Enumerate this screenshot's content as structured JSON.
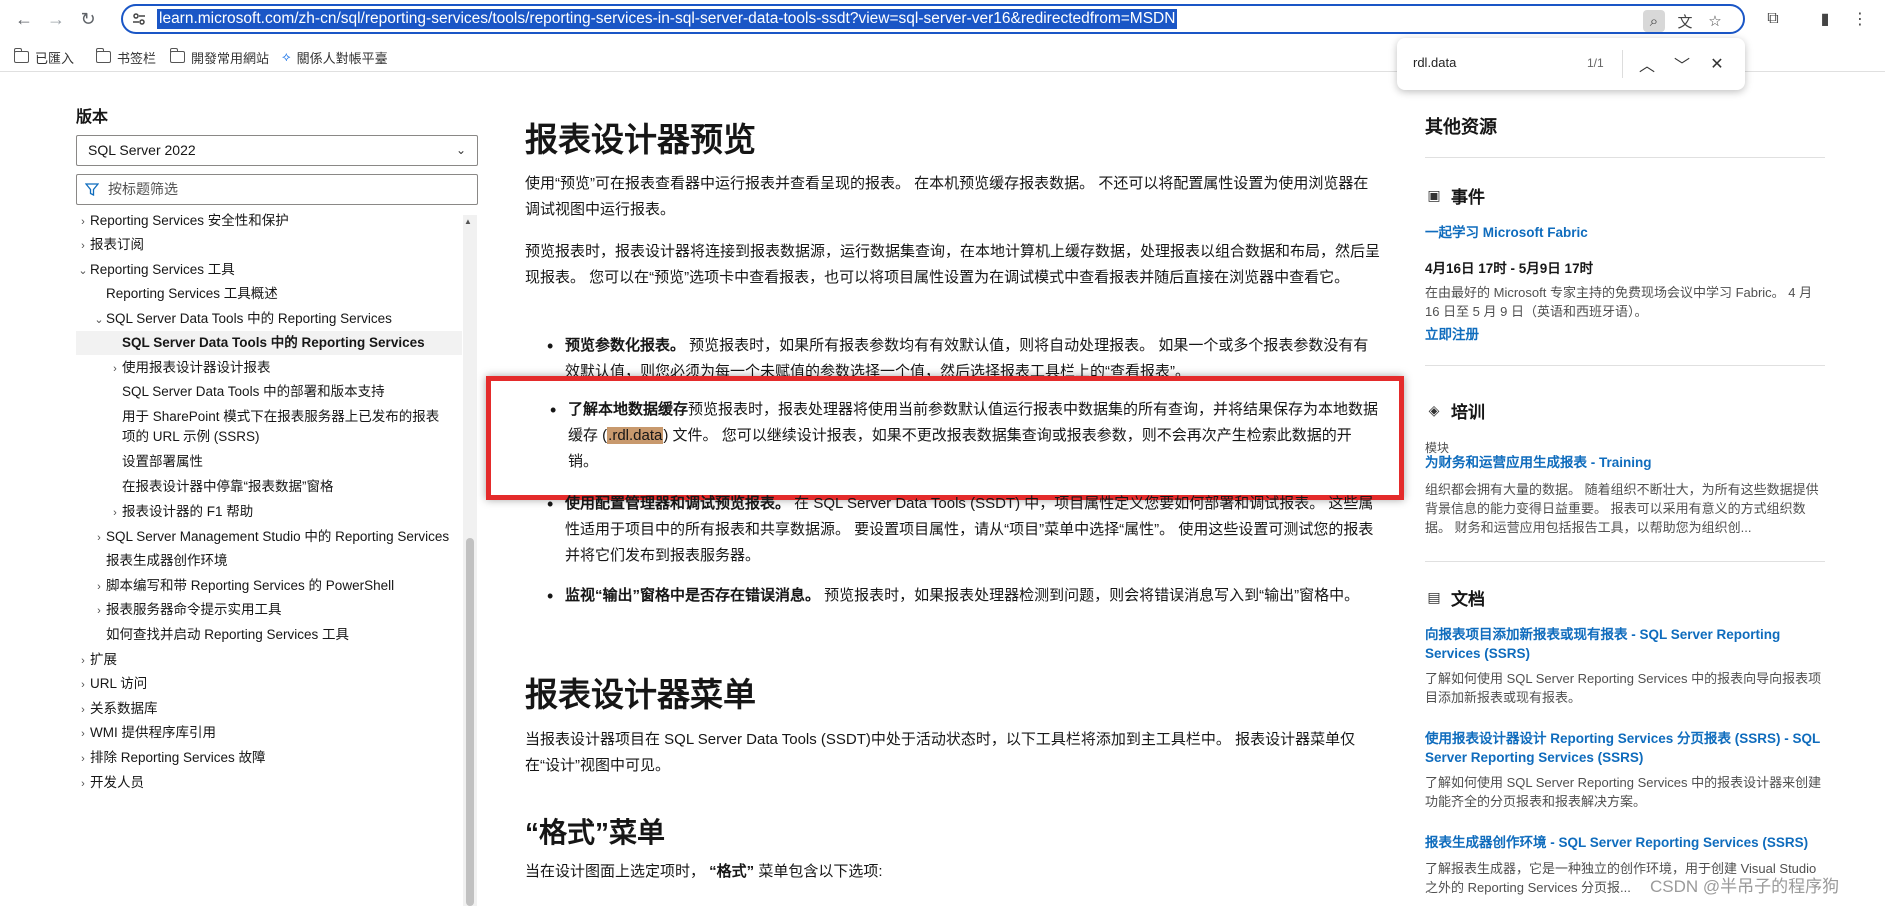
{
  "browser": {
    "url": "learn.microsoft.com/zh-cn/sql/reporting-services/tools/reporting-services-in-sql-server-data-tools-ssdt?view=sql-server-ver16&redirectedfrom=MSDN",
    "bookmarks": [
      "已匯入",
      "书签栏",
      "開發常用網站",
      "關係人對帳平臺"
    ]
  },
  "findbar": {
    "query": "rdl.data",
    "count": "1/1"
  },
  "sidebar": {
    "version_label": "版本",
    "version_value": "SQL Server 2022",
    "filter_placeholder": "按标题筛选",
    "toc": [
      {
        "label": "Reporting Services 安全性和保护",
        "arrow": "›"
      },
      {
        "label": "报表订阅",
        "arrow": "›"
      },
      {
        "label": "Reporting Services 工具",
        "arrow": "⌄"
      },
      {
        "label": "Reporting Services 工具概述",
        "arrow": ""
      },
      {
        "label": "SQL Server Data Tools 中的 Reporting Services",
        "arrow": "⌄"
      },
      {
        "label": "SQL Server Data Tools 中的 Reporting Services",
        "arrow": ""
      },
      {
        "label": "使用报表设计器设计报表",
        "arrow": "›"
      },
      {
        "label": "SQL Server Data Tools 中的部署和版本支持",
        "arrow": ""
      },
      {
        "label": "用于 SharePoint 模式下在报表服务器上已发布的报表",
        "arrow": ""
      },
      {
        "label": "项的 URL 示例 (SSRS)",
        "arrow": ""
      },
      {
        "label": "设置部署属性",
        "arrow": ""
      },
      {
        "label": "在报表设计器中停靠“报表数据”窗格",
        "arrow": ""
      },
      {
        "label": "报表设计器的 F1 帮助",
        "arrow": "›"
      },
      {
        "label": "SQL Server Management Studio 中的 Reporting Services",
        "arrow": "›"
      },
      {
        "label": "报表生成器创作环境",
        "arrow": ""
      },
      {
        "label": "脚本编写和带 Reporting Services 的 PowerShell",
        "arrow": "›"
      },
      {
        "label": "报表服务器命令提示实用工具",
        "arrow": "›"
      },
      {
        "label": "如何查找并启动 Reporting Services 工具",
        "arrow": ""
      },
      {
        "label": "扩展",
        "arrow": "›"
      },
      {
        "label": "URL 访问",
        "arrow": "›"
      },
      {
        "label": "关系数据库",
        "arrow": "›"
      },
      {
        "label": "WMI 提供程序库引用",
        "arrow": "›"
      },
      {
        "label": "排除 Reporting Services 故障",
        "arrow": "›"
      },
      {
        "label": "开发人员",
        "arrow": "›"
      }
    ]
  },
  "main": {
    "h1": "报表设计器预览",
    "p1": "使用“预览”可在报表查看器中运行报表并查看呈现的报表。 在本机预览缓存报表数据。 不还可以将配置属性设置为使用浏览器在调试视图中运行报表。",
    "p2": "预览报表时，报表设计器将连接到报表数据源，运行数据集查询，在本地计算机上缓存数据，处理报表以组合数据和布局，然后呈现报表。 您可以在“预览”选项卡中查看报表，也可以将项目属性设置为在调试模式中查看报表并随后直接在浏览器中查看它。",
    "b1_bold": "预览参数化报表。",
    "b1_text": " 预览报表时，如果所有报表参数均有有效默认值，则将自动处理报表。 如果一个或多个报表参数没有有效默认值，则您必须为每一个未赋值的参数选择一个值，然后选择报表工具栏上的“查看报表”。",
    "b2_bold": "了解本地数据缓存",
    "b2_text_a": "预览报表时，报表处理器将使用当前参数默认值运行报表中数据集的所有查询，并将结果保存为本地数据缓存 (",
    "b2_mark": ".rdl.data",
    "b2_text_b": ") 文件。 您可以继续设计报表，如果不更改报表数据集查询或报表参数，则不会再次产生检索此数据的开销。",
    "b3_bold": "使用配置管理器和调试预览报表。",
    "b3_text": " 在 SQL Server Data Tools (SSDT) 中，项目属性定义您要如何部署和调试报表。 这些属性适用于项目中的所有报表和共享数据源。 要设置项目属性，请从“项目”菜单中选择“属性”。 使用这些设置可测试您的报表并将它们发布到报表服务器。",
    "b4_bold": "监视“输出”窗格中是否存在错误消息。",
    "b4_text": " 预览报表时，如果报表处理器检测到问题，则会将错误消息写入到“输出”窗格中。",
    "h2": "报表设计器菜单",
    "p3": "当报表设计器项目在 SQL Server Data Tools (SSDT)中处于活动状态时，以下工具栏将添加到主工具栏中。 报表设计器菜单仅在“设计”视图中可见。",
    "h3": "“格式”菜单",
    "p4_a": "当在设计图面上选定项时， ",
    "p4_bold": "“格式”",
    "p4_b": " 菜单包含以下选项:"
  },
  "right": {
    "title": "其他资源",
    "events": {
      "heading": "事件",
      "link": "一起学习 Microsoft Fabric",
      "date": "4月16日 17时 - 5月9日 17时",
      "desc": "在由最好的 Microsoft 专家主持的免费现场会议中学习 Fabric。 4 月 16 日至 5 月 9 日（英语和西班牙语）。",
      "cta": "立即注册"
    },
    "training": {
      "heading": "培训",
      "kind": "模块",
      "link": "为财务和运营应用生成报表 - Training",
      "desc": "组织都会拥有大量的数据。 随着组织不断壮大，为所有这些数据提供背景信息的能力变得日益重要。 报表可以采用有意义的方式组织数据。 财务和运营应用包括报告工具，以帮助您为组织创..."
    },
    "docs": {
      "heading": "文档",
      "items": [
        {
          "link": "向报表项目添加新报表或现有报表 - SQL Server Reporting Services (SSRS)",
          "desc": "了解如何使用 SQL Server Reporting Services 中的报表向导向报表项目添加新报表或现有报表。"
        },
        {
          "link": "使用报表设计器设计 Reporting Services 分页报表 (SSRS) - SQL Server Reporting Services (SSRS)",
          "desc": "了解如何使用 SQL Server Reporting Services 中的报表设计器来创建功能齐全的分页报表和报表解决方案。"
        },
        {
          "link": "报表生成器创作环境 - SQL Server Reporting Services (SSRS)",
          "desc": "了解报表生成器，它是一种独立的创作环境，用于创建 Visual Studio 之外的 Reporting Services 分页报..."
        }
      ]
    }
  },
  "watermark": "CSDN @半吊子的程序狗"
}
